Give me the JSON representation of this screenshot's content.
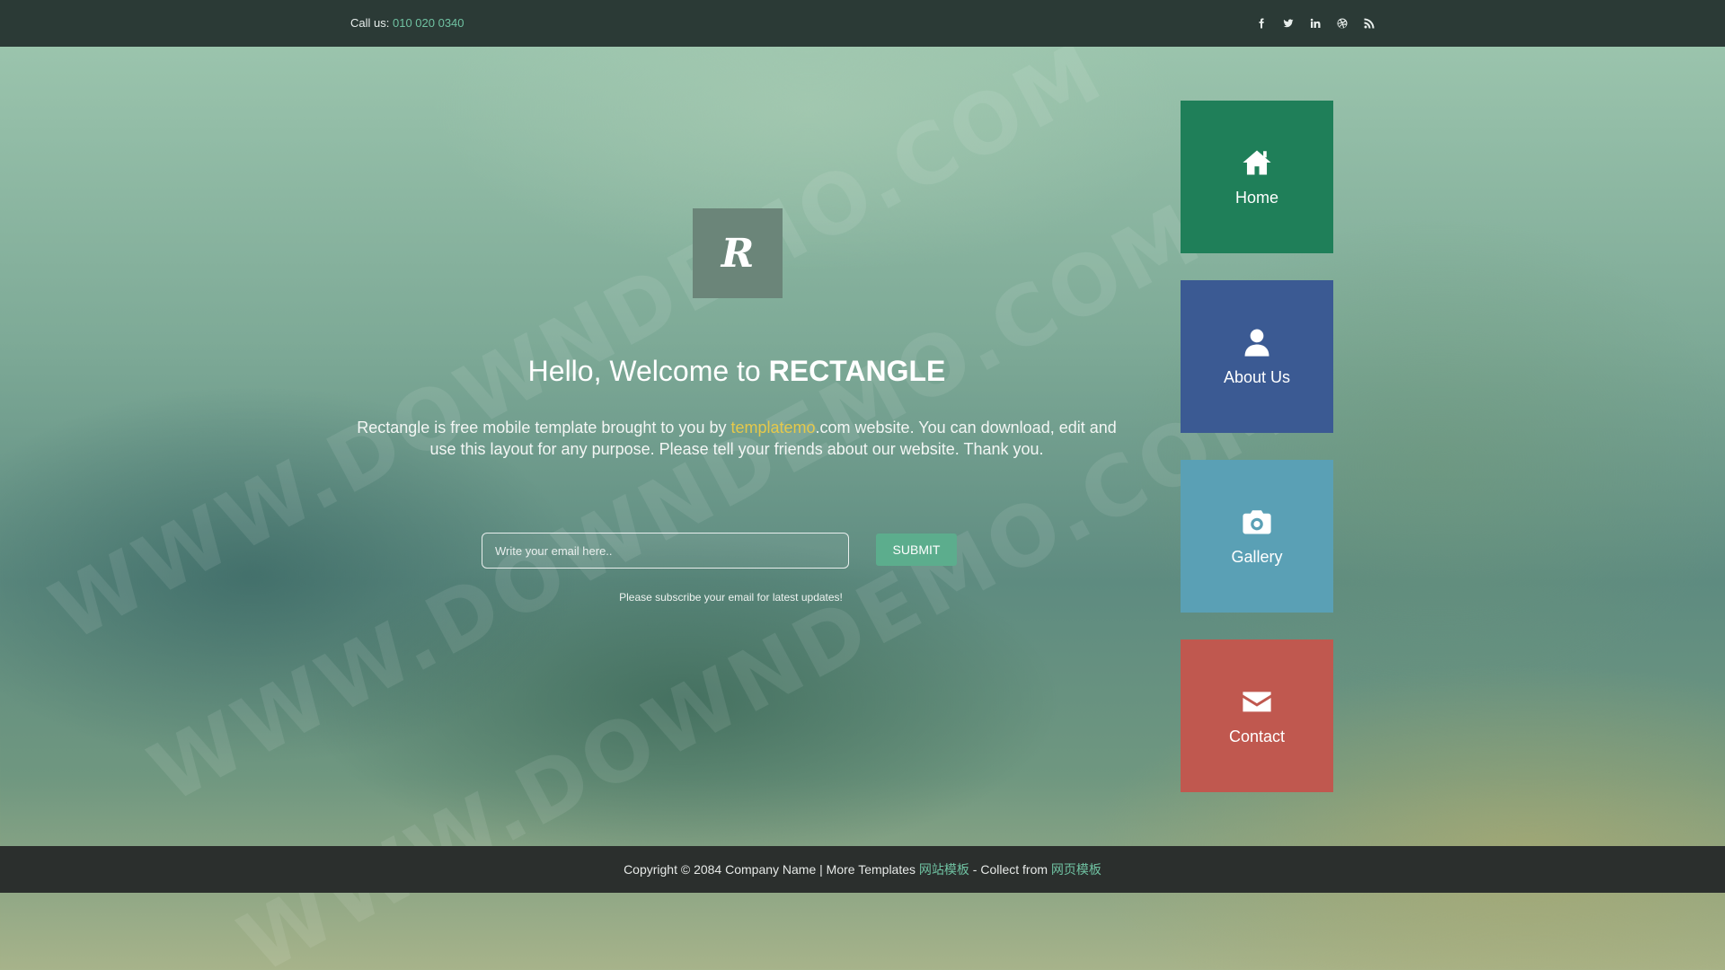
{
  "topbar": {
    "call_label": "Call us:",
    "phone": "010 020 0340",
    "social": [
      {
        "icon": "facebook-icon"
      },
      {
        "icon": "twitter-icon"
      },
      {
        "icon": "linkedin-icon"
      },
      {
        "icon": "dribbble-icon"
      },
      {
        "icon": "rss-icon"
      }
    ]
  },
  "watermark": {
    "text": "WWW.DOWNDEMO.COM"
  },
  "logo": {
    "letter": "R"
  },
  "main": {
    "welcome_prefix": "Hello, Welcome to",
    "brand": "RECTANGLE",
    "intro_before": "Rectangle is free mobile template brought to you by",
    "intro_link": "templatemo",
    "intro_after": ".com website. You can download, edit and use this layout for any purpose. Please tell your friends about our website. Thank you.",
    "email_placeholder": "Write your email here..",
    "submit_label": "SUBMIT",
    "subscribe_note": "Please subscribe your email for latest updates!"
  },
  "nav": {
    "home": "Home",
    "about": "About Us",
    "gallery": "Gallery",
    "contact": "Contact"
  },
  "colors": {
    "home": "#1f7f59",
    "about": "#3b5a93",
    "gallery": "#5aa0b5",
    "contact": "#c0584f",
    "accent": "#6fc1a1",
    "link_yellow": "#e6c94a"
  },
  "footer": {
    "copyright": "Copyright © 2084 Company Name | More Templates",
    "link1": "网站模板",
    "collect": "- Collect from",
    "link2": "网页模板"
  }
}
